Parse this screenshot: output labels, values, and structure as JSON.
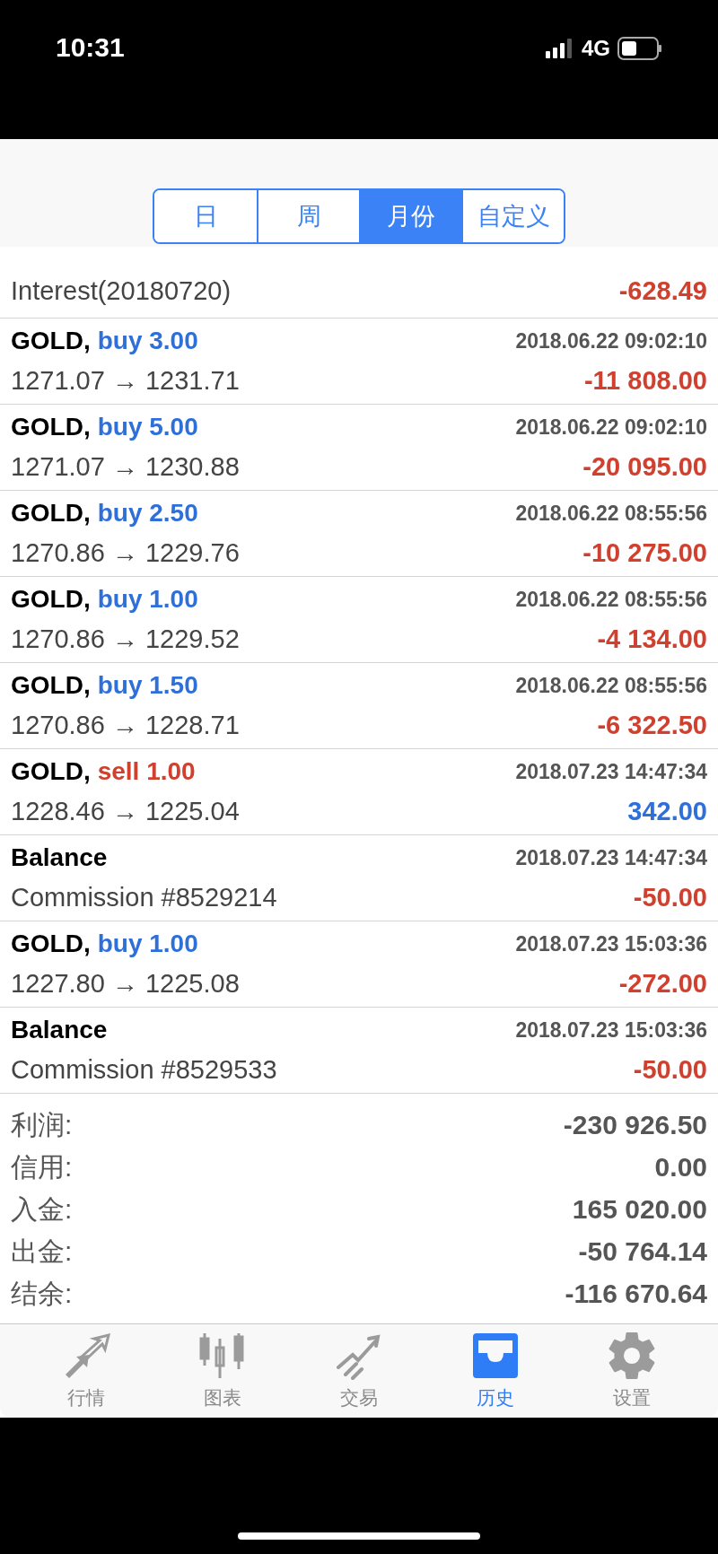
{
  "status_bar": {
    "time": "10:31",
    "network": "4G"
  },
  "periods": [
    {
      "label": "日",
      "selected": false
    },
    {
      "label": "周",
      "selected": false
    },
    {
      "label": "月份",
      "selected": true
    },
    {
      "label": "自定义",
      "selected": false
    }
  ],
  "first_row": {
    "comment": "Interest(20180720)",
    "profit": "-628.49",
    "color": "#d0402f"
  },
  "deals": [
    {
      "kind": "trade",
      "symbol": "GOLD,",
      "side": "buy",
      "volume": "3.00",
      "time": "2018.06.22 09:02:10",
      "detail": "1271.07 → 1231.71",
      "profit": "-11 808.00",
      "color": "#d0402f"
    },
    {
      "kind": "trade",
      "symbol": "GOLD,",
      "side": "buy",
      "volume": "5.00",
      "time": "2018.06.22 09:02:10",
      "detail": "1271.07 → 1230.88",
      "profit": "-20 095.00",
      "color": "#d0402f"
    },
    {
      "kind": "trade",
      "symbol": "GOLD,",
      "side": "buy",
      "volume": "2.50",
      "time": "2018.06.22 08:55:56",
      "detail": "1270.86 → 1229.76",
      "profit": "-10 275.00",
      "color": "#d0402f"
    },
    {
      "kind": "trade",
      "symbol": "GOLD,",
      "side": "buy",
      "volume": "1.00",
      "time": "2018.06.22 08:55:56",
      "detail": "1270.86 → 1229.52",
      "profit": "-4 134.00",
      "color": "#d0402f"
    },
    {
      "kind": "trade",
      "symbol": "GOLD,",
      "side": "buy",
      "volume": "1.50",
      "time": "2018.06.22 08:55:56",
      "detail": "1270.86 → 1228.71",
      "profit": "-6 322.50",
      "color": "#d0402f"
    },
    {
      "kind": "trade",
      "symbol": "GOLD,",
      "side": "sell",
      "volume": "1.00",
      "time": "2018.07.23 14:47:34",
      "detail": "1228.46 → 1225.04",
      "profit": "342.00",
      "color": "#2f6fd8"
    },
    {
      "kind": "balance",
      "symbol": "Balance",
      "time": "2018.07.23 14:47:34",
      "detail": "Commission #8529214",
      "profit": "-50.00",
      "color": "#d0402f"
    },
    {
      "kind": "trade",
      "symbol": "GOLD,",
      "side": "buy",
      "volume": "1.00",
      "time": "2018.07.23 15:03:36",
      "detail": "1227.80 → 1225.08",
      "profit": "-272.00",
      "color": "#d0402f"
    },
    {
      "kind": "balance",
      "symbol": "Balance",
      "time": "2018.07.23 15:03:36",
      "detail": "Commission #8529533",
      "profit": "-50.00",
      "color": "#d0402f"
    }
  ],
  "summary": [
    {
      "label": "利润:",
      "value": "-230 926.50"
    },
    {
      "label": "信用:",
      "value": "0.00"
    },
    {
      "label": "入金:",
      "value": "165 020.00"
    },
    {
      "label": "出金:",
      "value": "-50 764.14"
    },
    {
      "label": "结余:",
      "value": "-116 670.64"
    }
  ],
  "tab_bar": [
    {
      "kind": "quotes",
      "label": "行情",
      "selected": false
    },
    {
      "kind": "chart",
      "label": "图表",
      "selected": false
    },
    {
      "kind": "trade",
      "label": "交易",
      "selected": false
    },
    {
      "kind": "history",
      "label": "历史",
      "selected": true
    },
    {
      "kind": "settings",
      "label": "设置",
      "selected": false
    }
  ]
}
